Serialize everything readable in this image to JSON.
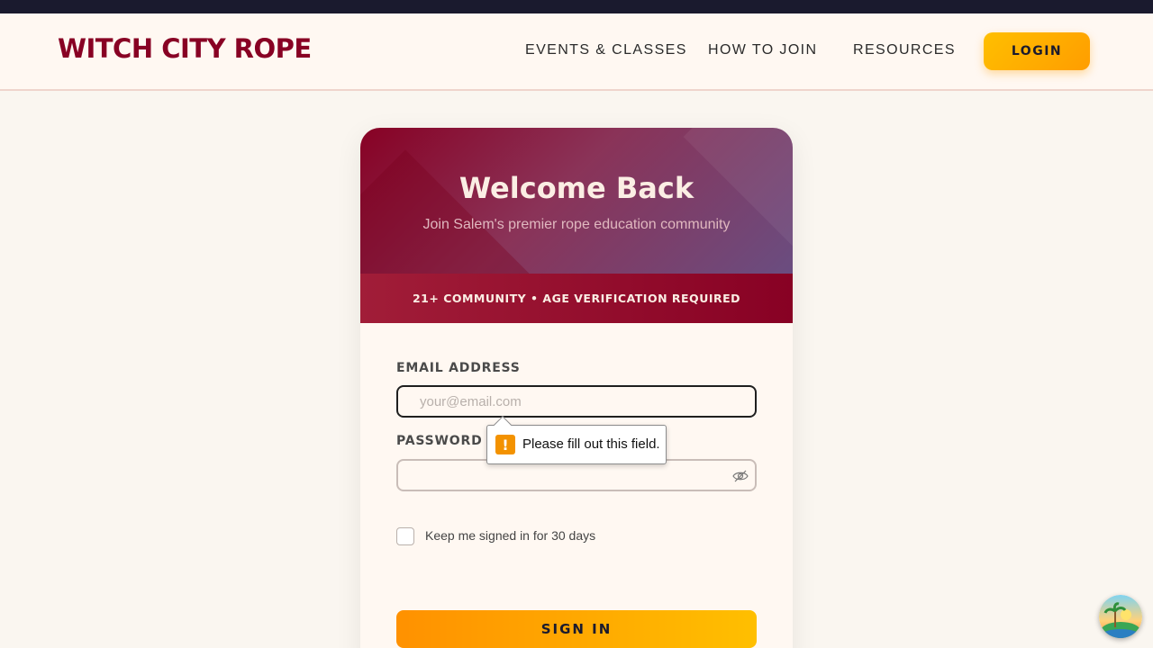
{
  "header": {
    "brand": "WITCH CITY ROPE",
    "nav": {
      "events": "EVENTS & CLASSES",
      "join": "HOW TO JOIN",
      "resources": "RESOURCES"
    },
    "login_label": "LOGIN"
  },
  "card": {
    "title": "Welcome Back",
    "subtitle": "Join Salem's premier rope education community",
    "age_banner": "21+ COMMUNITY • AGE VERIFICATION REQUIRED",
    "email_label": "EMAIL ADDRESS",
    "email_placeholder": "your@email.com",
    "email_value": "",
    "password_label": "PASSWORD",
    "password_value": "",
    "validation_message": "Please fill out this field.",
    "remember_label": "Keep me signed in for 30 days",
    "remember_checked": false,
    "signin_label": "SIGN IN"
  },
  "icons": {
    "password_toggle": "eye-slash-icon",
    "validation": "warning-icon",
    "assistant": "beach-avatar-icon"
  },
  "colors": {
    "brand": "#880124",
    "accent": "#ffbf00",
    "dark": "#1a1a2e",
    "background": "#faf6f0"
  }
}
